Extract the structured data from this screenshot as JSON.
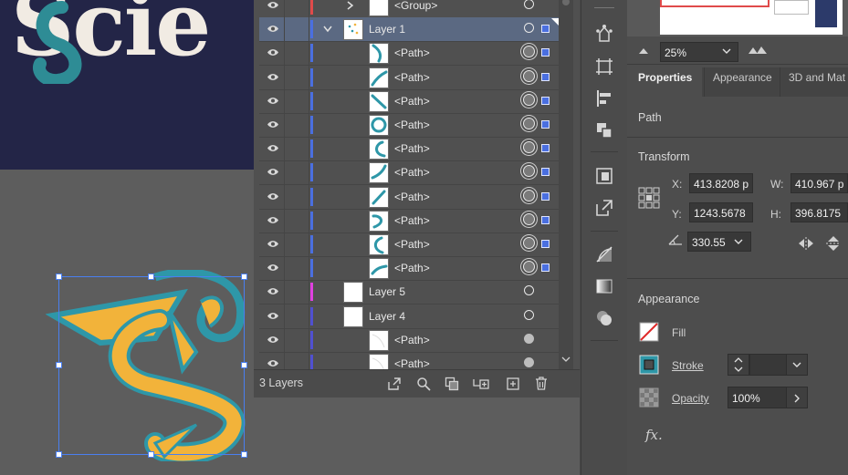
{
  "artboard": {
    "headline_fragment": "Scie"
  },
  "layers": {
    "rows": [
      {
        "label": "<Group>",
        "kind": "group",
        "color": "#e04a4a",
        "indent": 1,
        "selected": false,
        "target": "ring"
      },
      {
        "label": "Layer 1",
        "kind": "layer",
        "color": "#4a6fe0",
        "indent": 0,
        "selected": true,
        "target": "ring"
      },
      {
        "label": "<Path>",
        "kind": "path",
        "color": "#4a6fe0",
        "indent": 1,
        "selected": false,
        "target": "double"
      },
      {
        "label": "<Path>",
        "kind": "path",
        "color": "#4a6fe0",
        "indent": 1,
        "selected": false,
        "target": "double"
      },
      {
        "label": "<Path>",
        "kind": "path",
        "color": "#4a6fe0",
        "indent": 1,
        "selected": false,
        "target": "double"
      },
      {
        "label": "<Path>",
        "kind": "path",
        "color": "#4a6fe0",
        "indent": 1,
        "selected": false,
        "target": "double"
      },
      {
        "label": "<Path>",
        "kind": "path",
        "color": "#4a6fe0",
        "indent": 1,
        "selected": false,
        "target": "double"
      },
      {
        "label": "<Path>",
        "kind": "path",
        "color": "#4a6fe0",
        "indent": 1,
        "selected": false,
        "target": "double"
      },
      {
        "label": "<Path>",
        "kind": "path",
        "color": "#4a6fe0",
        "indent": 1,
        "selected": false,
        "target": "double"
      },
      {
        "label": "<Path>",
        "kind": "path",
        "color": "#4a6fe0",
        "indent": 1,
        "selected": false,
        "target": "double"
      },
      {
        "label": "<Path>",
        "kind": "path",
        "color": "#4a6fe0",
        "indent": 1,
        "selected": false,
        "target": "double"
      },
      {
        "label": "<Path>",
        "kind": "path",
        "color": "#4a6fe0",
        "indent": 1,
        "selected": false,
        "target": "double"
      },
      {
        "label": "Layer 5",
        "kind": "layer",
        "color": "#e040e0",
        "indent": 0,
        "selected": false,
        "target": "ring"
      },
      {
        "label": "Layer 4",
        "kind": "layer",
        "color": "#5050d0",
        "indent": 0,
        "selected": false,
        "target": "ring"
      },
      {
        "label": "<Path>",
        "kind": "path",
        "color": "#5050d0",
        "indent": 1,
        "selected": false,
        "target": "filled"
      },
      {
        "label": "<Path>",
        "kind": "path",
        "color": "#5050d0",
        "indent": 1,
        "selected": false,
        "target": "filled"
      }
    ],
    "footer_count": "3 Layers",
    "footer_icons": [
      "export-icon",
      "locate-object-icon",
      "collect-for-export-icon",
      "make-clipping-mask-icon",
      "new-sublayer-icon",
      "new-layer-icon",
      "delete-icon"
    ]
  },
  "navigator": {
    "zoom": "25%"
  },
  "properties": {
    "tabs": [
      "Properties",
      "Appearance",
      "3D and Mat"
    ],
    "active_tab": "Properties",
    "object_type": "Path",
    "transform": {
      "title": "Transform",
      "x_label": "X:",
      "x_value": "413.8208 p",
      "y_label": "Y:",
      "y_value": "1243.5678",
      "w_label": "W:",
      "w_value": "410.967 p",
      "h_label": "H:",
      "h_value": "396.8175",
      "angle_value": "330.55"
    },
    "appearance": {
      "title": "Appearance",
      "fill_label": "Fill",
      "stroke_label": "Stroke",
      "opacity_label": "Opacity",
      "opacity_value": "100%",
      "fx_label": "fx."
    }
  },
  "colors": {
    "accent": "#4a6fe0",
    "teal": "#2e97a8",
    "gold": "#f2b33a",
    "artboard": "#232547"
  }
}
